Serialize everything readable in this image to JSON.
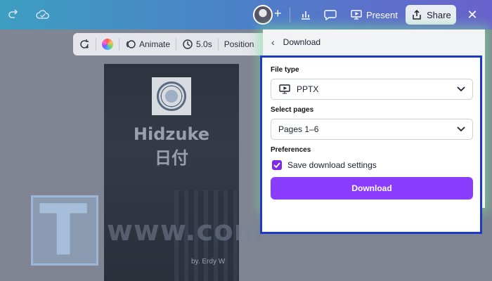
{
  "topbar": {
    "present_label": "Present",
    "share_label": "Share",
    "icons": [
      "redo-icon",
      "cloud-sync-icon",
      "avatar",
      "plus-icon",
      "statistics-icon",
      "comment-icon",
      "present-icon",
      "share-icon",
      "close-icon"
    ]
  },
  "canvas_toolbar": {
    "animate_label": "Animate",
    "duration_label": "5.0s",
    "position_label": "Position"
  },
  "design": {
    "title": "Hidzuke",
    "subtitle": "日付",
    "author": "by. Erdy W"
  },
  "watermark": {
    "letter": "T",
    "text": "www.com"
  },
  "download_panel": {
    "header": "Download",
    "file_type_label": "File type",
    "file_type_value": "PPTX",
    "select_pages_label": "Select pages",
    "select_pages_value": "Pages 1–6",
    "preferences_label": "Preferences",
    "save_settings_label": "Save download settings",
    "save_settings_checked": true,
    "download_button": "Download"
  },
  "colors": {
    "accent": "#8b3dff",
    "highlight_border": "#1d3bc2",
    "glow": "#78dc96"
  }
}
